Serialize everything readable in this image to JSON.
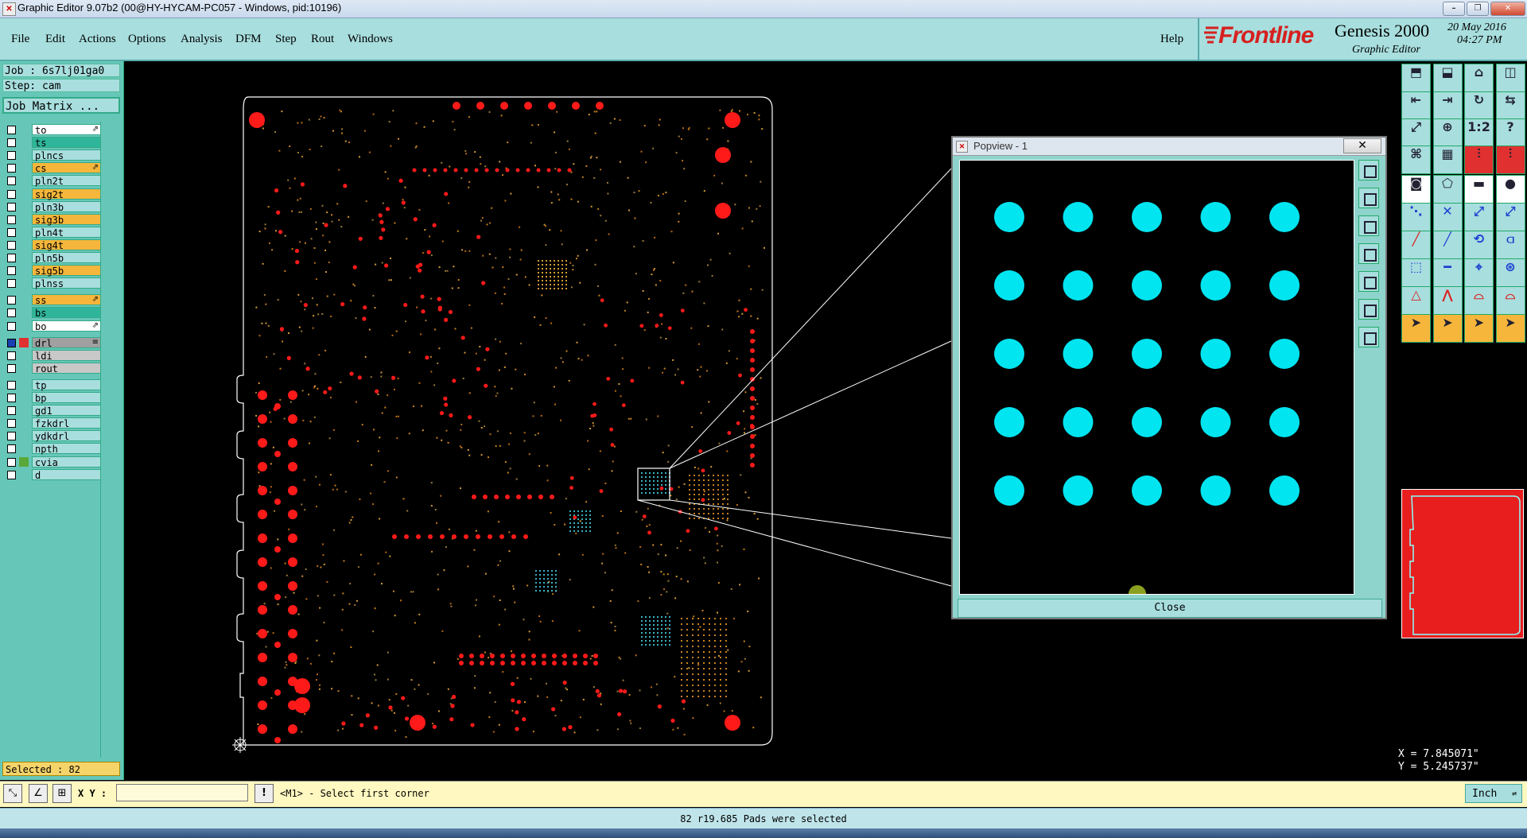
{
  "window": {
    "title": "Graphic Editor 9.07b2 (00@HY-HYCAM-PC057 - Windows, pid:10196)",
    "controls": [
      "–",
      "❐",
      "✕"
    ]
  },
  "menubar": {
    "items": [
      "File",
      "Edit",
      "Actions",
      "Options",
      "Analysis",
      "DFM",
      "Step",
      "Rout",
      "Windows"
    ],
    "help": "Help"
  },
  "logo": {
    "brand": "Frontline",
    "product": "Genesis 2000",
    "subtitle": "Graphic Editor",
    "date": "20 May 2016",
    "time": "04:27 PM"
  },
  "job": {
    "job_line": "Job : 6s7lj01ga0",
    "step_line": "Step: cam",
    "matrix_button": "Job Matrix ..."
  },
  "layers": [
    {
      "name": "to",
      "color": "#ffffff",
      "flag": "⇗"
    },
    {
      "name": "ts",
      "color": "#2fb59a",
      "flag": ""
    },
    {
      "name": "plncs",
      "color": "#a8dede",
      "flag": ""
    },
    {
      "name": "cs",
      "color": "#f5b63b",
      "flag": "⇗"
    },
    {
      "name": "pln2t",
      "color": "#a8dede",
      "flag": ""
    },
    {
      "name": "sig2t",
      "color": "#f5b63b",
      "flag": ""
    },
    {
      "name": "pln3b",
      "color": "#a8dede",
      "flag": ""
    },
    {
      "name": "sig3b",
      "color": "#f5b63b",
      "flag": ""
    },
    {
      "name": "pln4t",
      "color": "#a8dede",
      "flag": ""
    },
    {
      "name": "sig4t",
      "color": "#f5b63b",
      "flag": ""
    },
    {
      "name": "pln5b",
      "color": "#a8dede",
      "flag": ""
    },
    {
      "name": "sig5b",
      "color": "#f5b63b",
      "flag": ""
    },
    {
      "name": "plnss",
      "color": "#a8dede",
      "flag": ""
    },
    {
      "name": "ss",
      "color": "#f5b63b",
      "flag": "⇗"
    },
    {
      "name": "bs",
      "color": "#2fb59a",
      "flag": ""
    },
    {
      "name": "bo",
      "color": "#ffffff",
      "flag": "⇗"
    },
    {
      "name": "drl",
      "color": "#a0a0a0",
      "flag": "≡"
    },
    {
      "name": "ldi",
      "color": "#c8c8c8",
      "flag": ""
    },
    {
      "name": "rout",
      "color": "#c8c8c8",
      "flag": ""
    },
    {
      "name": "tp",
      "color": "#a8dede",
      "flag": ""
    },
    {
      "name": "bp",
      "color": "#a8dede",
      "flag": ""
    },
    {
      "name": "gd1",
      "color": "#a8dede",
      "flag": ""
    },
    {
      "name": "fzkdrl",
      "color": "#a8dede",
      "flag": ""
    },
    {
      "name": "ydkdrl",
      "color": "#a8dede",
      "flag": ""
    },
    {
      "name": "npth",
      "color": "#a8dede",
      "flag": ""
    },
    {
      "name": "cvia",
      "color": "#a8dede",
      "flag": ""
    },
    {
      "name": "d",
      "color": "#a8dede",
      "flag": ""
    }
  ],
  "popview": {
    "title": "Popview - 1",
    "close_button": "Close",
    "pad_color": "#00e5f0",
    "pad_rows": 5,
    "pad_cols": 5
  },
  "coords": {
    "x": "X = 7.845071\"",
    "y": "Y = 5.245737\""
  },
  "selection": {
    "selected_text": "Selected : 82"
  },
  "command": {
    "xy_label": "X Y :",
    "xy_value": "",
    "prompt": "<M1> - Select first corner",
    "units": "Inch"
  },
  "status": {
    "message": "82 r19.685 Pads were selected"
  },
  "colors": {
    "panel_teal": "#a8dede",
    "pad_red": "#ff1a1a",
    "trace_orange": "#c8801e",
    "accent_cyan": "#00e5f0"
  }
}
